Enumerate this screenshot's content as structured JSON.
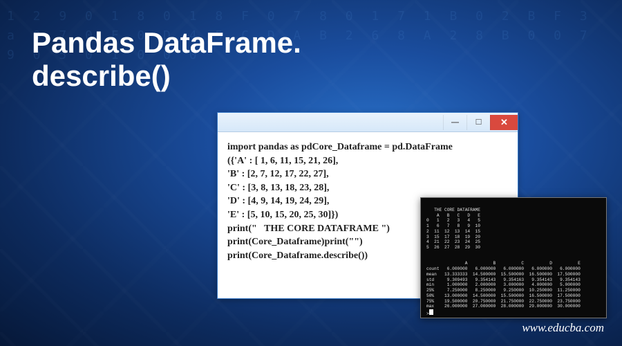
{
  "title_line1": "Pandas DataFrame.",
  "title_line2": "describe()",
  "code_window": {
    "code": "import pandas as pdCore_Dataframe = pd.DataFrame\n({'A' : [ 1, 6, 11, 15, 21, 26],\n'B' : [2, 7, 12, 17, 22, 27],\n'C' : [3, 8, 13, 18, 23, 28],\n'D' : [4, 9, 14, 19, 24, 29],\n'E' : [5, 10, 15, 20, 25, 30]})\nprint(\"   THE CORE DATAFRAME \")\nprint(Core_Dataframe)print(\"\")\nprint(Core_Dataframe.describe())"
  },
  "terminal": {
    "header": "   THE CORE DATAFRAME ",
    "data_table": "    A   B   C   D   E\n0   1   2   3   4   5\n1   6   7   8   9  10\n2  11  12  13  14  15\n3  15  17  18  19  20\n4  21  22  23  24  25\n5  26  27  28  29  30",
    "blank": "",
    "describe_table": "               A          B          C          D          E\ncount   6.000000   6.000000   6.000000   6.000000   6.000000\nmean   13.333333  14.500000  15.500000  16.500000  17.500000\nstd     9.309493   9.354143   9.354163   9.354143   9.354143\nmin     1.000000   2.000000   3.000000   4.000000   5.000000\n25%     7.250000   8.250000   9.250000  10.250000  11.250000\n50%    13.000000  14.500000  15.500000  16.500000  17.500000\n75%    19.500000  20.750000  21.750000  22.750000  23.750000\nmax    26.000000  27.000000  28.000000  29.000000  30.000000"
  },
  "website": "www.educba.com",
  "bg_digits": "1 2 9 0 1 8 0 1 8  F 0 7 8  0 1 7  1 B 0 2 B F  3 a 0 7  0 F 0  D 4 5 C D  A B 2 6  8 A 2 8  B 0 0 7  9 0  5 0  1 0 0 0"
}
